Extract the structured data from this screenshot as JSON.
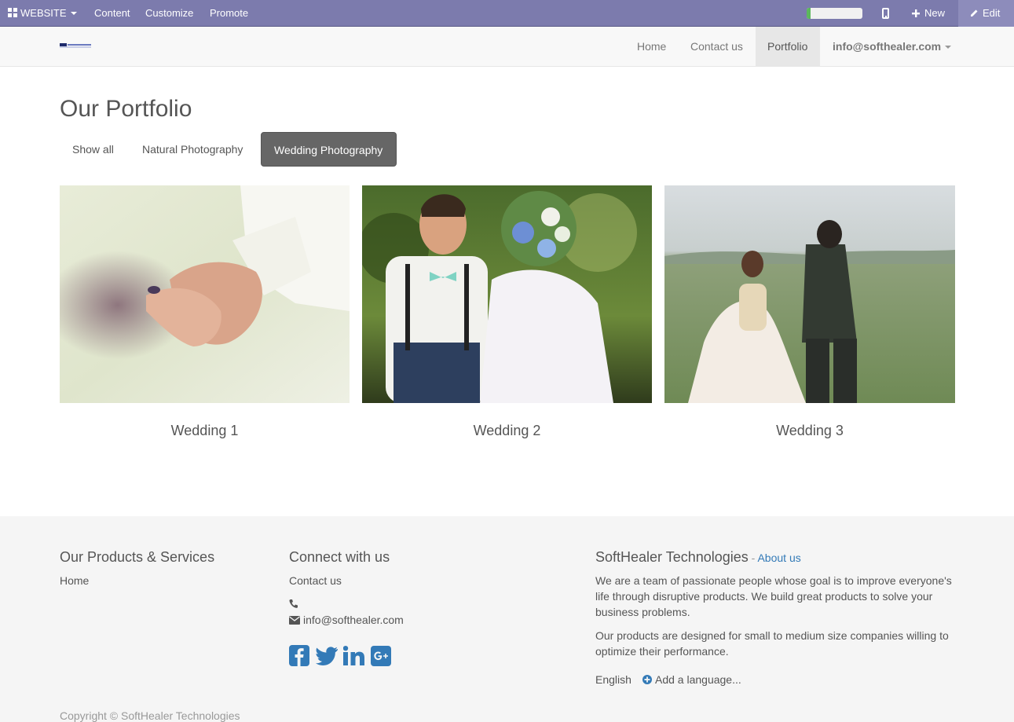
{
  "topbar": {
    "website_label": "WEBSITE",
    "content_label": "Content",
    "customize_label": "Customize",
    "promote_label": "Promote",
    "progress_fraction": 0.07,
    "new_label": "New",
    "edit_label": "Edit"
  },
  "navbar": {
    "items": [
      {
        "label": "Home"
      },
      {
        "label": "Contact us"
      },
      {
        "label": "Portfolio",
        "active": true
      }
    ],
    "user_label": "info@softhealer.com"
  },
  "main": {
    "title": "Our Portfolio",
    "filters": [
      {
        "label": "Show all"
      },
      {
        "label": "Natural Photography"
      },
      {
        "label": "Wedding Photography",
        "active": true
      }
    ],
    "cards": [
      {
        "title": "Wedding 1",
        "image": "holding-hands-photo"
      },
      {
        "title": "Wedding 2",
        "image": "couple-with-bouquet-photo"
      },
      {
        "title": "Wedding 3",
        "image": "couple-walking-field-photo"
      }
    ]
  },
  "footer": {
    "products": {
      "title": "Our Products & Services",
      "links": [
        "Home"
      ]
    },
    "connect": {
      "title": "Connect with us",
      "contact_link": "Contact us",
      "email": "info@softhealer.com"
    },
    "about": {
      "title": "SoftHealer Technologies",
      "separator": " - ",
      "about_link": "About us",
      "para1": "We are a team of passionate people whose goal is to improve everyone's life through disruptive products. We build great products to solve your business problems.",
      "para2": "Our products are designed for small to medium size companies willing to optimize their performance."
    },
    "language": {
      "current": "English",
      "add_label": "Add a language..."
    },
    "copyright": "Copyright © SoftHealer Technologies"
  },
  "colors": {
    "topbar_bg": "#7c7bad",
    "link": "#337ab7",
    "active_filter_bg": "#666666"
  }
}
